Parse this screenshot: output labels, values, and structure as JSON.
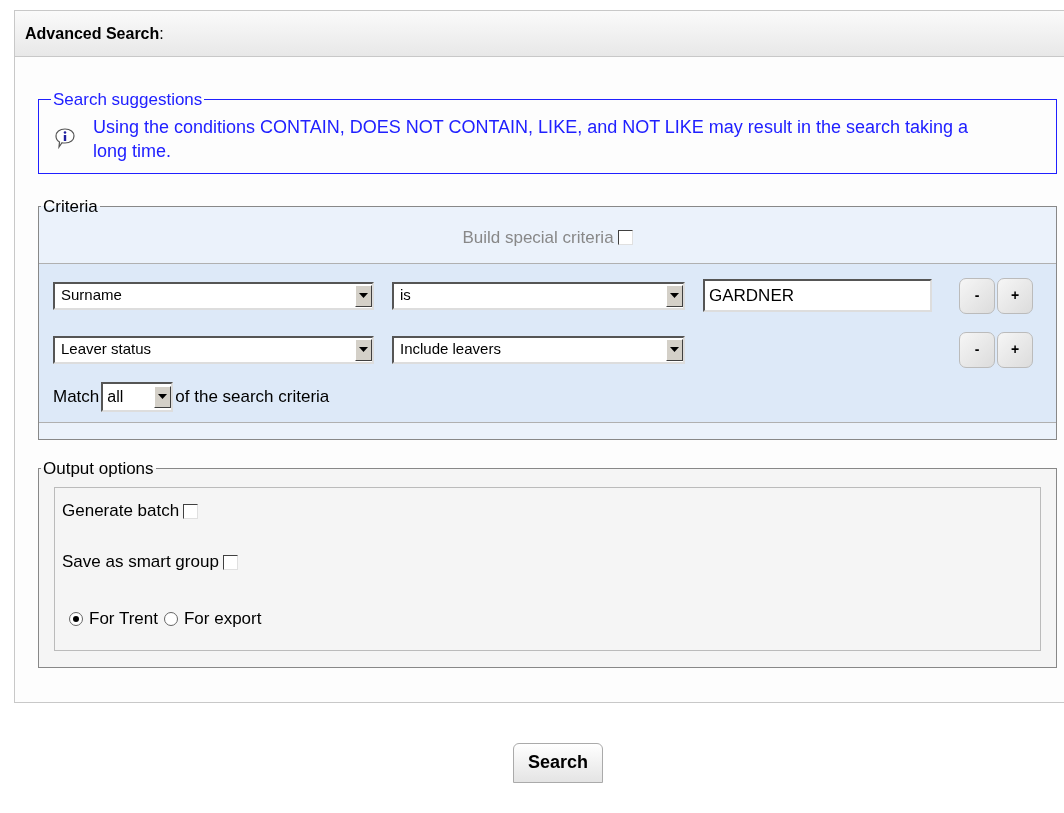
{
  "panel": {
    "title": "**Advanced Search**:"
  },
  "suggestions": {
    "legend": "Search suggestions",
    "message": "Using the conditions CONTAIN, DOES NOT CONTAIN, LIKE, and NOT LIKE may result in the search taking a long time."
  },
  "criteria": {
    "legend": "Criteria",
    "special": {
      "label": "Build special criteria",
      "checked": false,
      "disabled": true
    },
    "rows": [
      {
        "field": "Surname",
        "condition": "is",
        "value": "GARDNER",
        "minus": "-",
        "plus": "+"
      },
      {
        "field": "Leaver status",
        "condition": "Include leavers",
        "minus": "-",
        "plus": "+"
      }
    ],
    "match": {
      "before": "Match",
      "value": "all",
      "after": "of the search criteria"
    }
  },
  "output": {
    "legend": "Output options",
    "checkboxes": [
      {
        "label": "Generate batch",
        "checked": false
      },
      {
        "label": "Save as smart group",
        "checked": false
      }
    ],
    "radios": [
      {
        "label": "For Trent",
        "selected": true
      },
      {
        "label": "For export",
        "selected": false
      }
    ]
  },
  "button": "Search"
}
